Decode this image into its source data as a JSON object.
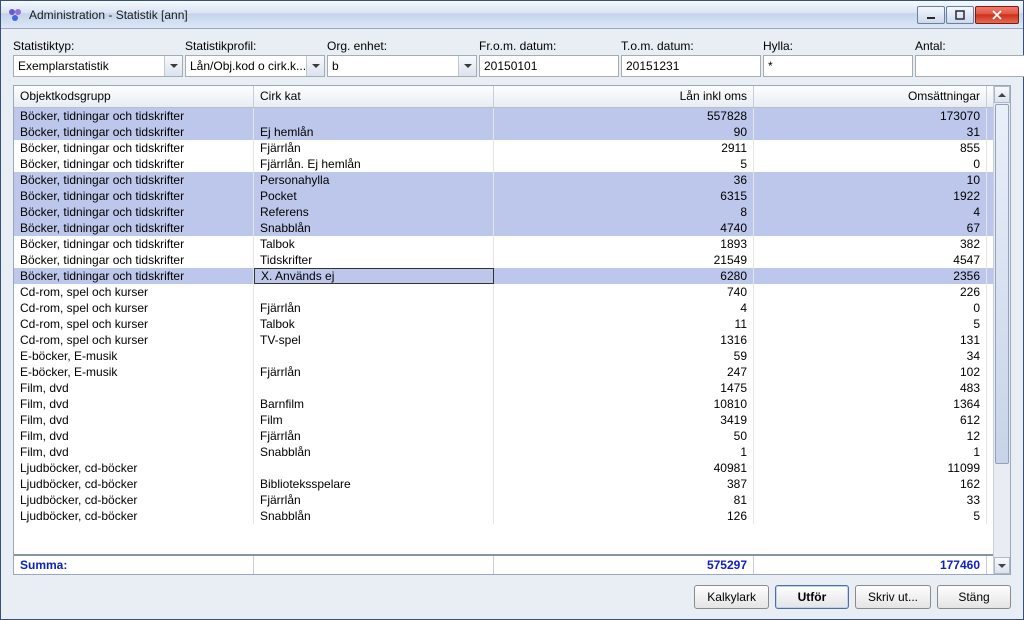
{
  "window": {
    "title": "Administration - Statistik [ann]"
  },
  "filters": {
    "type": {
      "label": "Statistiktyp:",
      "value": "Exemplarstatistik"
    },
    "profile": {
      "label": "Statistikprofil:",
      "value": "Lån/Obj.kod o cirk.k..."
    },
    "org": {
      "label": "Org. enhet:",
      "value": "b"
    },
    "from": {
      "label": "Fr.o.m. datum:",
      "value": "20150101"
    },
    "to": {
      "label": "T.o.m. datum:",
      "value": "20151231"
    },
    "shelf": {
      "label": "Hylla:",
      "value": "*"
    },
    "count": {
      "label": "Antal:",
      "value": ""
    }
  },
  "table": {
    "headers": {
      "c1": "Objektkodsgrupp",
      "c2": "Cirk kat",
      "c3": "Lån inkl oms",
      "c4": "Omsättningar"
    },
    "rows": [
      {
        "g": "Böcker, tidningar och tidskrifter",
        "k": "",
        "l": "557828",
        "o": "173070",
        "hl": true
      },
      {
        "g": "Böcker, tidningar och tidskrifter",
        "k": "Ej hemlån",
        "l": "90",
        "o": "31",
        "hl": true
      },
      {
        "g": "Böcker, tidningar och tidskrifter",
        "k": "Fjärrlån",
        "l": "2911",
        "o": "855"
      },
      {
        "g": "Böcker, tidningar och tidskrifter",
        "k": "Fjärrlån. Ej hemlån",
        "l": "5",
        "o": "0"
      },
      {
        "g": "Böcker, tidningar och tidskrifter",
        "k": "Personahylla",
        "l": "36",
        "o": "10",
        "hl": true
      },
      {
        "g": "Böcker, tidningar och tidskrifter",
        "k": "Pocket",
        "l": "6315",
        "o": "1922",
        "hl": true
      },
      {
        "g": "Böcker, tidningar och tidskrifter",
        "k": "Referens",
        "l": "8",
        "o": "4",
        "hl": true
      },
      {
        "g": "Böcker, tidningar och tidskrifter",
        "k": "Snabblån",
        "l": "4740",
        "o": "67",
        "hl": true
      },
      {
        "g": "Böcker, tidningar och tidskrifter",
        "k": "Talbok",
        "l": "1893",
        "o": "382"
      },
      {
        "g": "Böcker, tidningar och tidskrifter",
        "k": "Tidskrifter",
        "l": "21549",
        "o": "4547"
      },
      {
        "g": "Böcker, tidningar och tidskrifter",
        "k": "X. Används ej",
        "l": "6280",
        "o": "2356",
        "hl": true,
        "sel": true
      },
      {
        "g": "Cd-rom, spel och kurser",
        "k": "",
        "l": "740",
        "o": "226"
      },
      {
        "g": "Cd-rom, spel och kurser",
        "k": "Fjärrlån",
        "l": "4",
        "o": "0"
      },
      {
        "g": "Cd-rom, spel och kurser",
        "k": "Talbok",
        "l": "11",
        "o": "5"
      },
      {
        "g": "Cd-rom, spel och kurser",
        "k": "TV-spel",
        "l": "1316",
        "o": "131"
      },
      {
        "g": "E-böcker, E-musik",
        "k": "",
        "l": "59",
        "o": "34"
      },
      {
        "g": "E-böcker, E-musik",
        "k": "Fjärrlån",
        "l": "247",
        "o": "102"
      },
      {
        "g": "Film, dvd",
        "k": "",
        "l": "1475",
        "o": "483"
      },
      {
        "g": "Film, dvd",
        "k": "Barnfilm",
        "l": "10810",
        "o": "1364"
      },
      {
        "g": "Film, dvd",
        "k": "Film",
        "l": "3419",
        "o": "612"
      },
      {
        "g": "Film, dvd",
        "k": "Fjärrlån",
        "l": "50",
        "o": "12"
      },
      {
        "g": "Film, dvd",
        "k": "Snabblån",
        "l": "1",
        "o": "1"
      },
      {
        "g": "Ljudböcker, cd-böcker",
        "k": "",
        "l": "40981",
        "o": "11099"
      },
      {
        "g": "Ljudböcker, cd-böcker",
        "k": "Biblioteksspelare",
        "l": "387",
        "o": "162"
      },
      {
        "g": "Ljudböcker, cd-böcker",
        "k": "Fjärrlån",
        "l": "81",
        "o": "33"
      },
      {
        "g": "Ljudböcker, cd-böcker",
        "k": "Snabblån",
        "l": "126",
        "o": "5"
      }
    ],
    "footer": {
      "label": "Summa:",
      "l": "575297",
      "o": "177460"
    }
  },
  "buttons": {
    "sheet": "Kalkylark",
    "run": "Utför",
    "print": "Skriv ut...",
    "close": "Stäng"
  }
}
